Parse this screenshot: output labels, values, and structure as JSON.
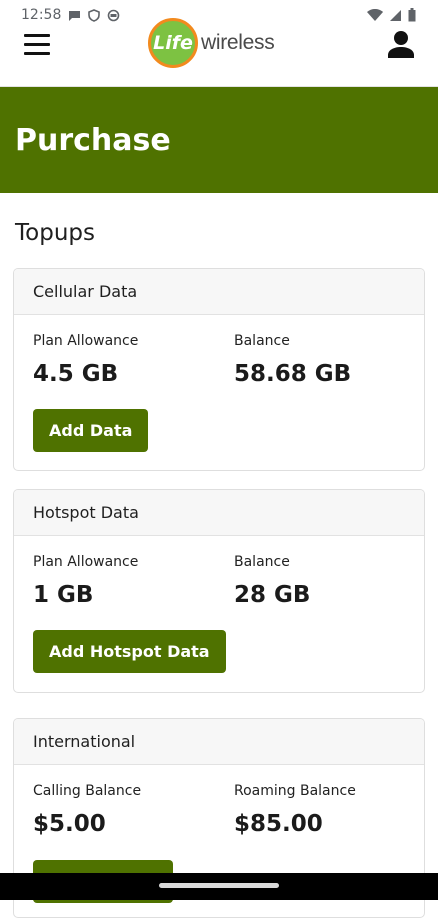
{
  "status": {
    "time": "12:58",
    "icons": [
      "chat-icon",
      "shield-icon",
      "ring-icon",
      "wifi-icon",
      "signal-icon",
      "battery-icon"
    ]
  },
  "appbar": {
    "logo_mark": "Life",
    "logo_word": "wireless"
  },
  "page": {
    "title": "Purchase",
    "section": "Topups"
  },
  "cards": [
    {
      "header": "Cellular Data",
      "left_label": "Plan Allowance",
      "left_value": "4.5 GB",
      "right_label": "Balance",
      "right_value": "58.68 GB",
      "button": "Add Data"
    },
    {
      "header": "Hotspot Data",
      "left_label": "Plan Allowance",
      "left_value": "1 GB",
      "right_label": "Balance",
      "right_value": "28 GB",
      "button": "Add Hotspot Data"
    },
    {
      "header": "International",
      "left_label": "Calling Balance",
      "left_value": "$5.00",
      "right_label": "Roaming Balance",
      "right_value": "$85.00",
      "button": ""
    }
  ],
  "colors": {
    "brand_green": "#4f7200",
    "logo_green": "#7dc242",
    "logo_orange": "#f28a1e"
  }
}
